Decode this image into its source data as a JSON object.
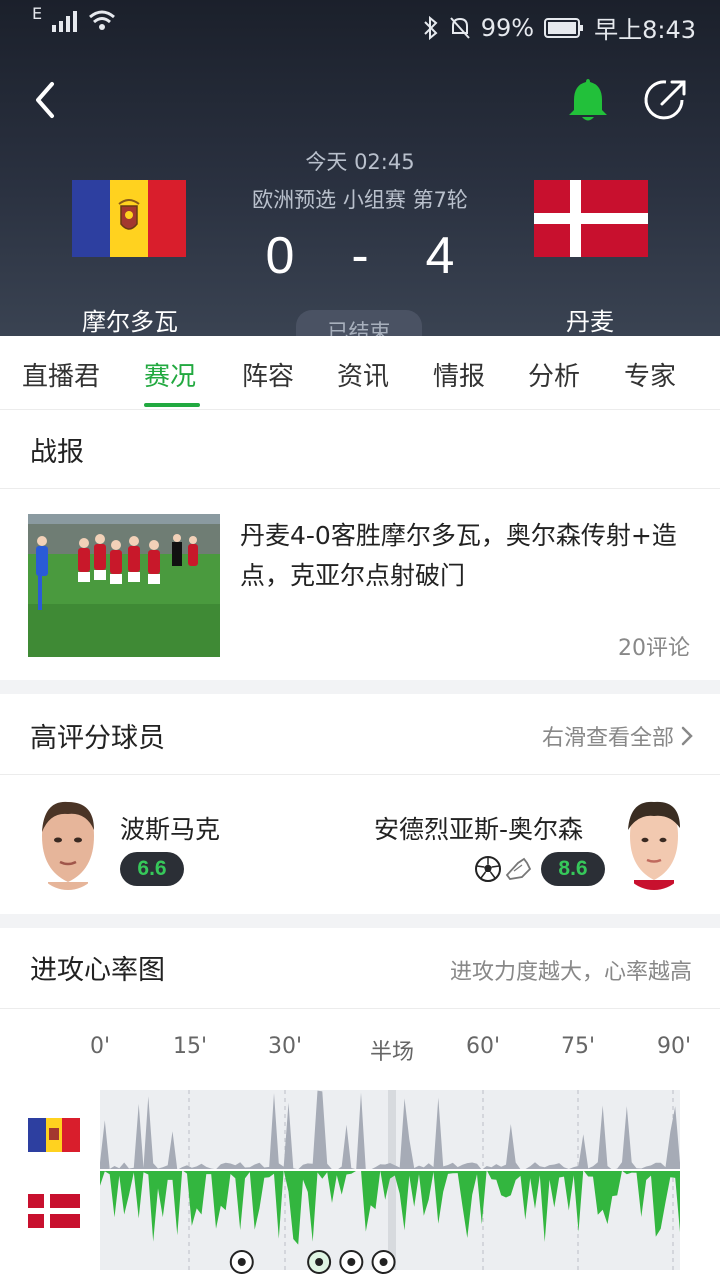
{
  "status_bar": {
    "network": "E",
    "battery": "99%",
    "time": "早上8:43"
  },
  "header": {
    "match_time": "今天 02:45",
    "competition": "欧洲预选 小组赛 第7轮",
    "home_score": "0",
    "score_sep": "-",
    "away_score": "4",
    "home_team": "摩尔多瓦",
    "away_team": "丹麦",
    "match_status": "已结束",
    "icons": [
      "back-icon",
      "bell-icon",
      "share-icon"
    ],
    "bell_color": "#22c03a"
  },
  "tabs": [
    {
      "label": "直播君"
    },
    {
      "label": "赛况"
    },
    {
      "label": "阵容"
    },
    {
      "label": "资讯"
    },
    {
      "label": "情报"
    },
    {
      "label": "分析"
    },
    {
      "label": "专家"
    }
  ],
  "active_tab": "赛况",
  "accent_color": "#22a940",
  "report": {
    "title": "战报",
    "headline": "丹麦4-0客胜摩尔多瓦，奥尔森传射+造点，克亚尔点射破门",
    "comments": "20评论"
  },
  "top_players": {
    "title": "高评分球员",
    "see_all": "右滑查看全部",
    "home": {
      "name": "波斯马克",
      "rating": "6.6"
    },
    "away": {
      "name": "安德烈亚斯-奥尔森",
      "rating": "8.6",
      "icons": [
        "football-icon",
        "boot-icon"
      ]
    }
  },
  "attack_chart": {
    "title": "进攻心率图",
    "subtitle": "进攻力度越大，心率越高",
    "time_labels": [
      "0'",
      "15'",
      "30'",
      "半场",
      "60'",
      "75'",
      "90'"
    ],
    "home_color": "#a6abb6",
    "away_color": "#33b63f",
    "goal_minutes": [
      22,
      34,
      39,
      44
    ]
  }
}
